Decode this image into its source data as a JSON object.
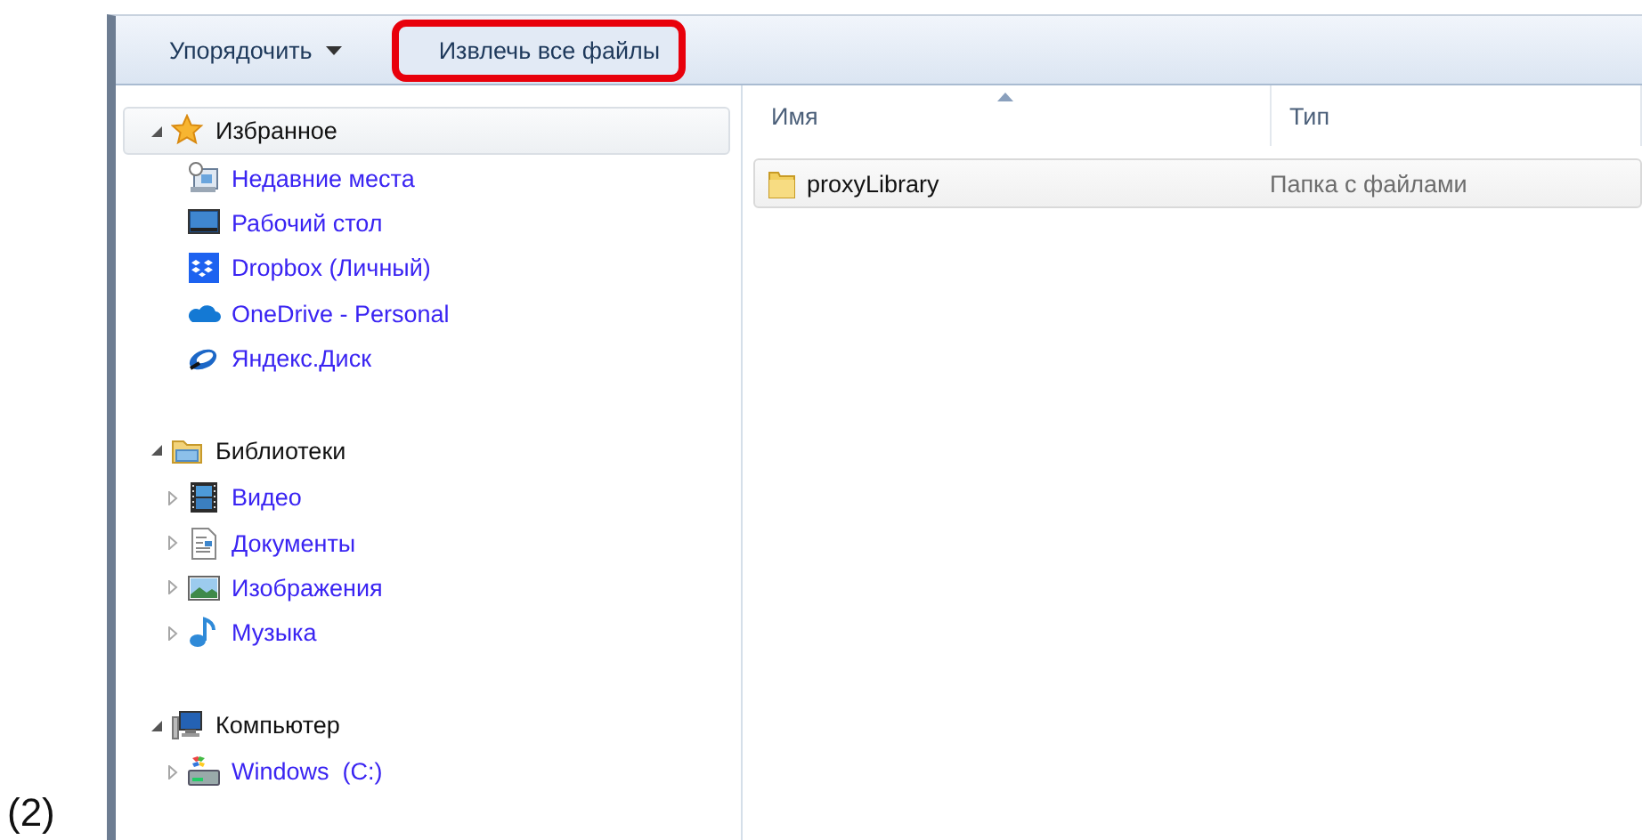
{
  "step_label": "(2)",
  "toolbar": {
    "buttons": [
      {
        "label": "Упорядочить",
        "kind": "dropdown",
        "highlighted": false
      },
      {
        "label": "Извлечь все файлы",
        "kind": "plain",
        "highlighted": true
      }
    ]
  },
  "navigation": {
    "groups": [
      {
        "label": "Избранное",
        "kind": "star",
        "expanded": true,
        "selected": true,
        "children": [
          {
            "label": "Недавние места",
            "kind": "recent"
          },
          {
            "label": "Рабочий стол",
            "kind": "desktop"
          },
          {
            "label": "Dropbox (Личный)",
            "kind": "dropbox"
          },
          {
            "label": "OneDrive - Personal",
            "kind": "cloud"
          },
          {
            "label": "Яндекс.Диск",
            "kind": "disk"
          }
        ]
      },
      {
        "label": "Библиотеки",
        "kind": "library",
        "expanded": true,
        "selected": false,
        "children": [
          {
            "label": "Видео",
            "kind": "video",
            "expanded": false
          },
          {
            "label": "Документы",
            "kind": "documents",
            "expanded": false
          },
          {
            "label": "Изображения",
            "kind": "pictures",
            "expanded": false
          },
          {
            "label": "Музыка",
            "kind": "music",
            "expanded": false
          }
        ]
      },
      {
        "label": "Компьютер",
        "kind": "computer",
        "expanded": true,
        "selected": false,
        "children": [
          {
            "label": "Windows  (C:)",
            "kind": "drive",
            "expanded": false
          }
        ]
      }
    ]
  },
  "file_list": {
    "columns": [
      {
        "label": "Имя",
        "sorted": true
      },
      {
        "label": "Тип",
        "sorted": false
      }
    ],
    "rows": [
      {
        "name": "proxyLibrary",
        "type": "Папка с файлами",
        "selected": true
      }
    ]
  }
}
